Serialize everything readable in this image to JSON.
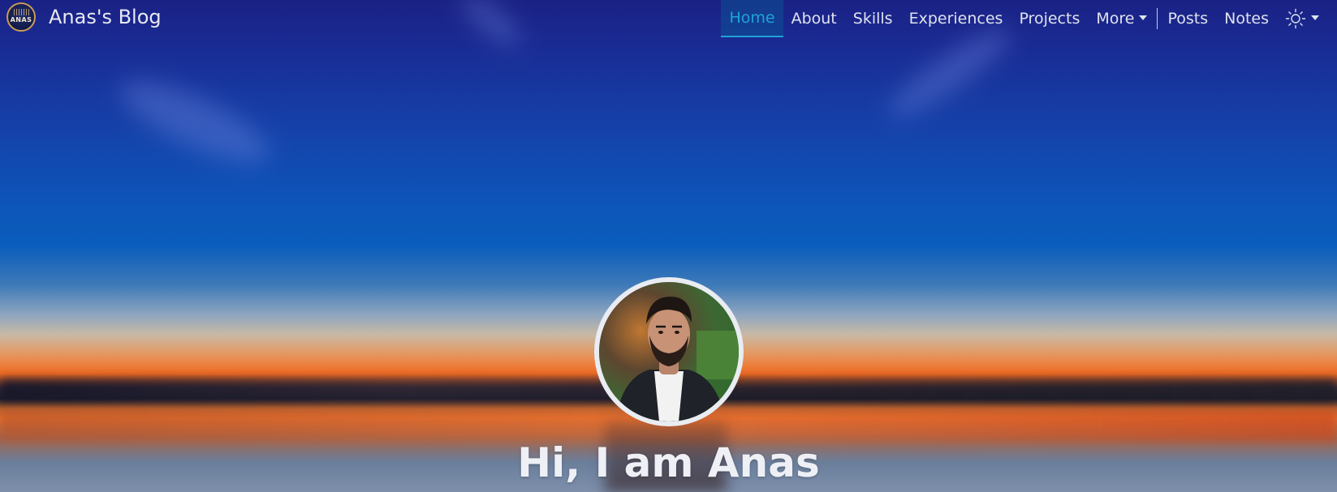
{
  "brand": {
    "logo_text": "ANAS",
    "name": "Anas's Blog"
  },
  "nav": {
    "items": [
      {
        "label": "Home",
        "active": true
      },
      {
        "label": "About"
      },
      {
        "label": "Skills"
      },
      {
        "label": "Experiences"
      },
      {
        "label": "Projects"
      },
      {
        "label": "More",
        "dropdown": true
      }
    ],
    "secondary": [
      {
        "label": "Posts"
      },
      {
        "label": "Notes"
      }
    ],
    "theme_icon": "sun-icon"
  },
  "hero": {
    "greeting": "Hi, I am Anas",
    "avatar_icon": "profile-photo"
  },
  "colors": {
    "active_nav": "#1fa3d6",
    "nav_text": "#dfe3ef",
    "sky_top": "#1a2184",
    "sky_mid": "#0a5dbc",
    "sunset": "#f06a22"
  }
}
